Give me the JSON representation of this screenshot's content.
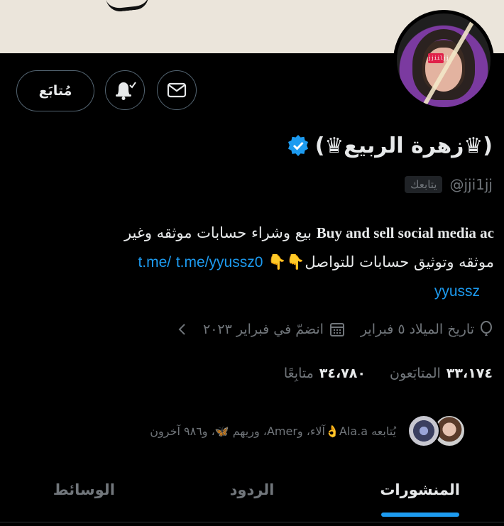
{
  "profile": {
    "display_name": "(♛زهرة الربيع♛)",
    "verified": true,
    "handle": "@jji1jj",
    "follows_you_label": "يتابعك",
    "bio_english": "Buy and sell social media ac",
    "bio_arabic_1": "بيع وشراء حسابات موثقه وغير",
    "bio_arabic_2": "موثقه وتوثيق حسابات  للتواصل",
    "bio_emojis": "👇👇",
    "bio_link_1": "t.me/yyussz0",
    "bio_link_2": "t.me/",
    "bio_link_2_cont": "yyussz",
    "avatar_badge": "jjiiljj"
  },
  "actions": {
    "follow_label": "مُتابَع"
  },
  "meta": {
    "birthday": "تاريخ الميلاد ٥ فبراير",
    "joined": "انضمّ في فبراير ٢٠٢٣"
  },
  "stats": {
    "followers_count": "٣٣،١٧٤",
    "followers_label": "المتابَعون",
    "following_count": "٣٤،٧٨٠",
    "following_label": "متابِعًا"
  },
  "followed_by": {
    "text": "يُتابعه Ala.a👌آلاء، وAmer، وريهم 🦋، و٩٨٦ آخرون"
  },
  "tabs": [
    {
      "label": "المنشورات",
      "active": true
    },
    {
      "label": "الردود",
      "active": false
    },
    {
      "label": "الوسائط",
      "active": false
    }
  ],
  "colors": {
    "accent": "#1d9bf0",
    "background": "#000000",
    "muted": "#71767b",
    "text": "#e7e9ea"
  }
}
